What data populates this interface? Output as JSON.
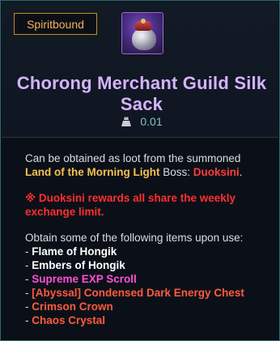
{
  "tooltip": {
    "badge": "Spiritbound",
    "item_icon": "silk-sack-icon",
    "title": "Chorong Merchant Guild Silk Sack",
    "weight_icon": "weight-icon",
    "weight_value": "0.01",
    "lines": {
      "obtained_prefix": "Can be obtained as loot from the summoned",
      "location": "Land of the Morning Light",
      "boss_label": "Boss:",
      "boss_name": "Duoksini",
      "boss_period": ".",
      "note_symbol": "※",
      "note_text": "Duoksini rewards all share the weekly exchange limit.",
      "use_intro": "Obtain some of the following items upon use:"
    },
    "items": [
      {
        "prefix": "- ",
        "name": "Flame of Hongik",
        "color": "#ffffff"
      },
      {
        "prefix": "- ",
        "name": "Embers of Hongik",
        "color": "#ffffff"
      },
      {
        "prefix": "- ",
        "name": "Supreme EXP Scroll",
        "color": "#ff4fd8"
      },
      {
        "prefix": "- ",
        "name": "[Abyssal] Condensed Dark Energy Chest",
        "color": "#ff5a3d"
      },
      {
        "prefix": "- ",
        "name": "Crimson Crown",
        "color": "#ff5a3d"
      },
      {
        "prefix": "- ",
        "name": "Chaos Crystal",
        "color": "#ff5a3d"
      }
    ],
    "colors": {
      "border": "#2a6b74",
      "badge_border": "#c48a2c",
      "badge_text": "#f1b25a",
      "title": "#d7b2ff",
      "weight_value": "#7ec6c0",
      "location": "#f2c14e",
      "boss_name": "#ff3b3b"
    }
  }
}
